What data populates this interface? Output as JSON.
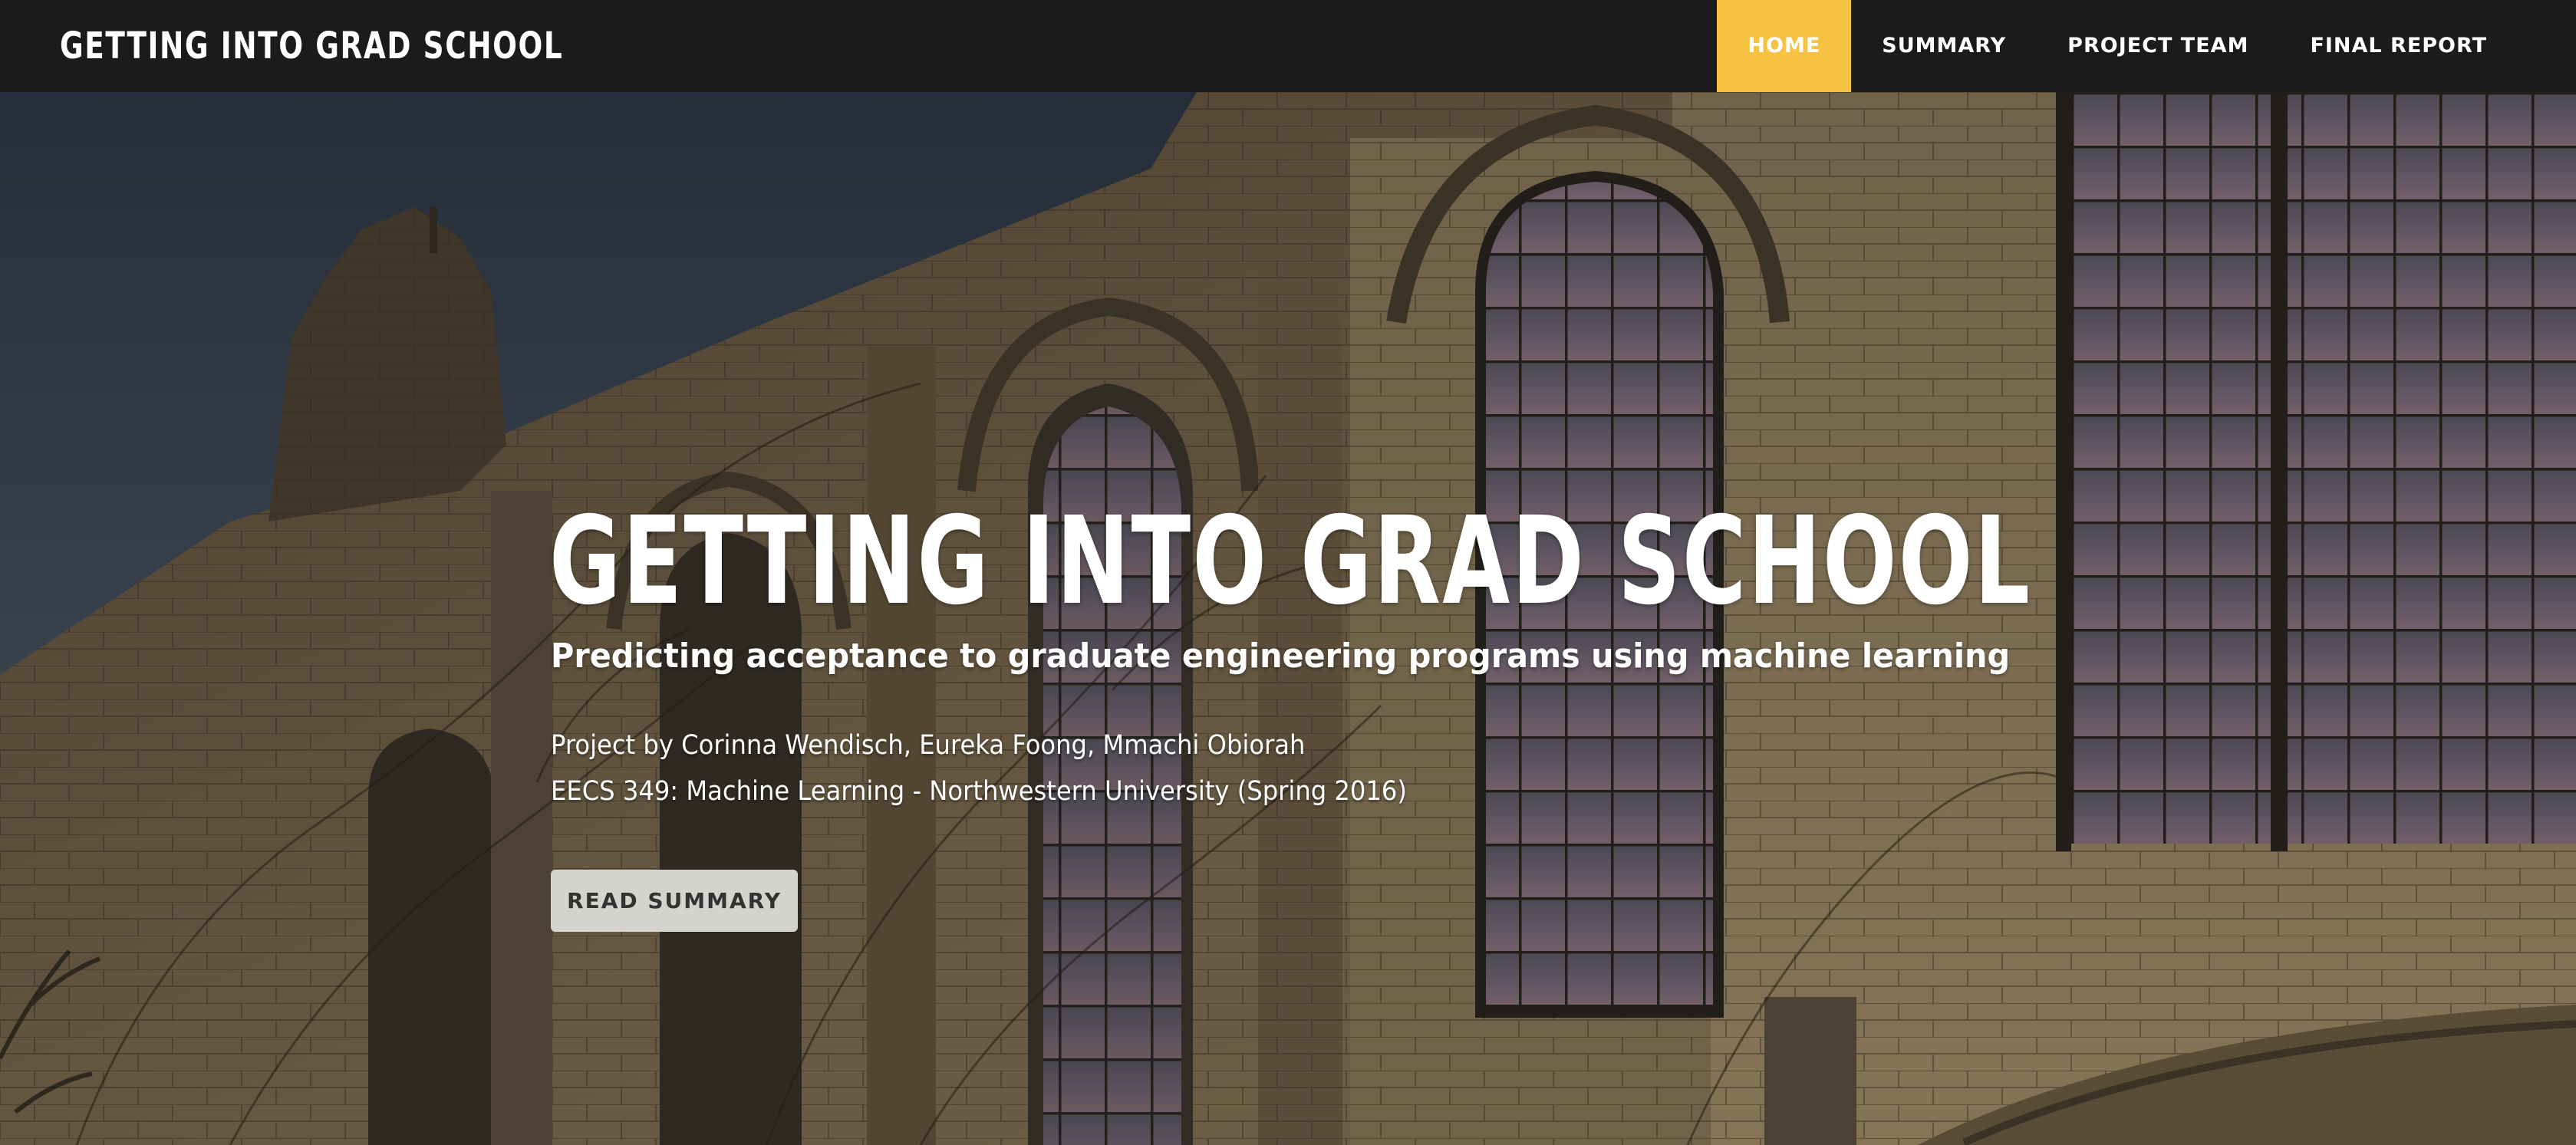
{
  "navbar": {
    "brand": "GETTING INTO GRAD SCHOOL",
    "items": [
      {
        "label": "HOME",
        "active": true
      },
      {
        "label": "SUMMARY",
        "active": false
      },
      {
        "label": "PROJECT TEAM",
        "active": false
      },
      {
        "label": "FINAL REPORT",
        "active": false
      }
    ],
    "accent_color": "#f5c242"
  },
  "hero": {
    "title": "GETTING INTO GRAD SCHOOL",
    "subtitle": "Predicting acceptance to graduate engineering programs using machine learning",
    "authors": "Project by Corinna Wendisch, Eureka Foong, Mmachi Obiorah",
    "course": "EECS 349: Machine Learning - Northwestern University (Spring 2016)",
    "button_label": "READ SUMMARY"
  }
}
